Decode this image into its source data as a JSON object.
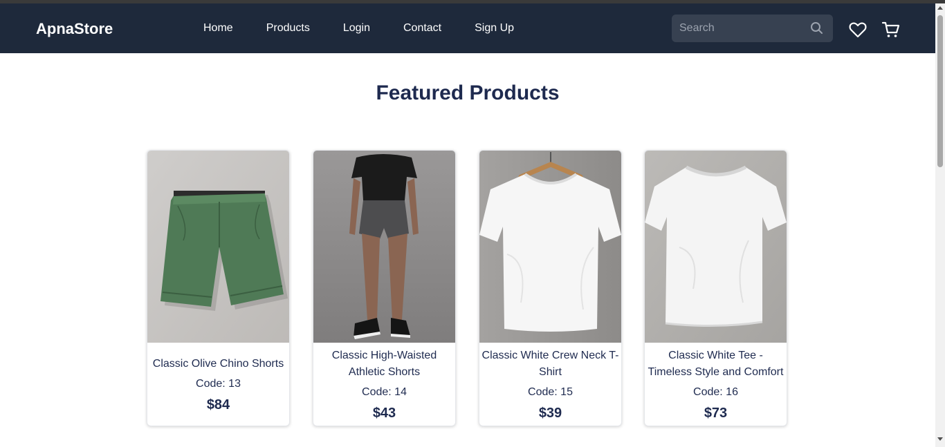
{
  "header": {
    "brand": "ApnaStore",
    "nav": [
      "Home",
      "Products",
      "Login",
      "Contact",
      "Sign Up"
    ],
    "search_placeholder": "Search",
    "search_value": ""
  },
  "icons": {
    "search": "search-icon",
    "wishlist": "heart-icon",
    "cart": "cart-icon"
  },
  "main": {
    "heading": "Featured Products",
    "products": [
      {
        "name": "Classic Olive Chino Shorts",
        "code": "Code: 13",
        "price": "$84",
        "image": "olive-chino-shorts"
      },
      {
        "name": "Classic High-Waisted Athletic Shorts",
        "code": "Code: 14",
        "price": "$43",
        "image": "model-athletic-shorts"
      },
      {
        "name": "Classic White Crew Neck T-Shirt",
        "code": "Code: 15",
        "price": "$39",
        "image": "white-tshirt-on-hanger"
      },
      {
        "name": "Classic White Tee - Timeless Style and Comfort",
        "code": "Code: 16",
        "price": "$73",
        "image": "white-tee-flat"
      }
    ]
  },
  "colors": {
    "navbar": "#1e293b",
    "search_bg": "#374151",
    "heading": "#1e2a4f"
  }
}
